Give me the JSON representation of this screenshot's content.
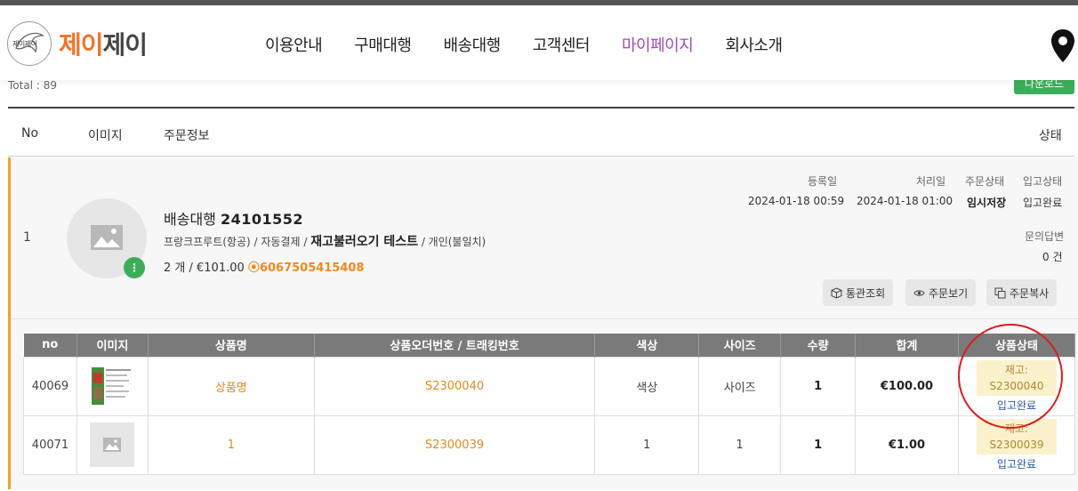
{
  "header": {
    "logo_badge": "제이제이",
    "logo_main": "제이",
    "logo_main2": "제이",
    "nav": [
      "이용안내",
      "구매대행",
      "배송대행",
      "고객센터",
      "마이페이지",
      "회사소개"
    ],
    "active_nav": "마이페이지"
  },
  "list": {
    "total": "Total : 89",
    "download_label": "다운로드",
    "columns": {
      "no": "No",
      "image": "이미지",
      "info": "주문정보",
      "status": "상태"
    }
  },
  "order": {
    "no": "1",
    "type": "배송대행",
    "order_number": "24101552",
    "route": "프랑크프루트(항공) / 자동결제 / ",
    "name": "재고불러오기 테스트",
    "customs": " / 개인(불일치)",
    "qty_price": "2 개 / €101.00",
    "tracking": "6067505415408",
    "meta_labels": {
      "registered": "등록일",
      "processed": "처리일",
      "order_status": "주문상태",
      "warehouse_status": "입고상태"
    },
    "registered": "2024-01-18 00:59",
    "processed": "2024-01-18 01:00",
    "order_status": "임시저장",
    "warehouse_status": "입고완료",
    "inquiry_label": "문의답변",
    "inquiry_count": "0 건",
    "buttons": {
      "customs": "통관조회",
      "view": "주문보기",
      "copy": "주문복사"
    }
  },
  "items": {
    "headers": [
      "no",
      "이미지",
      "상품명",
      "상품오더번호 / 트래킹번호",
      "색상",
      "사이즈",
      "수량",
      "합계",
      "상품상태"
    ],
    "rows": [
      {
        "no": "40069",
        "name": "상품명",
        "order_no": "S2300040",
        "color": "색상",
        "size": "사이즈",
        "qty": "1",
        "total": "€100.00",
        "stock_line1": "재고:",
        "stock_line2": "S2300040",
        "status": "입고완료"
      },
      {
        "no": "40071",
        "name": "1",
        "order_no": "S2300039",
        "color": "1",
        "size": "1",
        "qty": "1",
        "total": "€1.00",
        "stock_line1": "재고:",
        "stock_line2": "S2300039",
        "status": "입고완료"
      }
    ]
  }
}
